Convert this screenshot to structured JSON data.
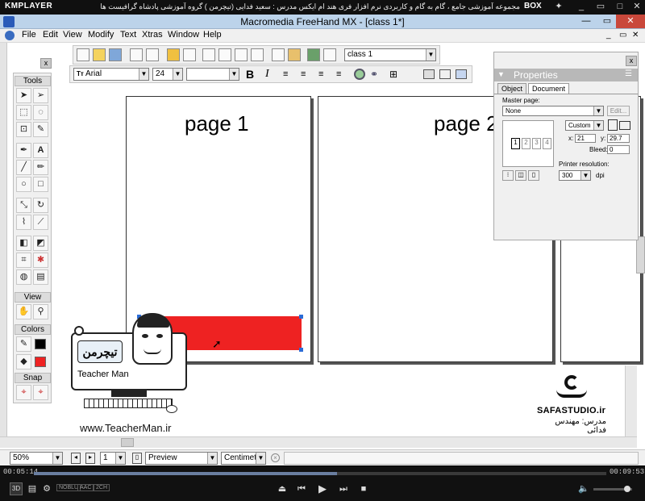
{
  "player": {
    "logo": "KMPLAYER",
    "title": "مجموعه آموزشی جامع ، گام به گام و کاربردی نرم افزار فری هند ام ایکس   مدرس : سعید فدایی (تیچرمن ) گروه آموزشی پادشاه گرافیست ها",
    "box_label": "BOX",
    "time_current": "00:05:14",
    "time_total": "00:09:53",
    "progress": 0.53,
    "badges": [
      "NOBLU",
      "AAC",
      "2CH"
    ]
  },
  "app": {
    "title": "Macromedia FreeHand MX - [class 1*]",
    "menu": [
      "File",
      "Edit",
      "View",
      "Modify",
      "Text",
      "Xtras",
      "Window",
      "Help"
    ]
  },
  "toolbar": {
    "document_select": "class 1",
    "font_name": "Arial",
    "font_size": "24",
    "bold_label": "B",
    "italic_label": "I"
  },
  "tools_panel": {
    "title": "Tools",
    "view_title": "View",
    "colors_title": "Colors",
    "snap_title": "Snap",
    "close": "x"
  },
  "pages": [
    {
      "label": "page 1"
    },
    {
      "label": "page 2"
    }
  ],
  "properties": {
    "title": "Properties",
    "tabs": [
      "Object",
      "Document"
    ],
    "master_page_label": "Master page:",
    "master_page_value": "None",
    "edit_button": "Edit...",
    "page_size_value": "Custom",
    "x_label": "x:",
    "x_value": "21",
    "y_label": "y:",
    "y_value": "29.7",
    "bleed_label": "Bleed:",
    "bleed_value": "0",
    "thumbs": [
      "1",
      "2",
      "3",
      "4"
    ],
    "printer_resolution_label": "Printer resolution:",
    "printer_resolution_value": "300",
    "dpi_label": "dpi"
  },
  "status": {
    "zoom": "50%",
    "page_number": "1",
    "view_mode": "Preview",
    "units": "Centimeters"
  },
  "watermarks": {
    "teacherman_url": "www.TeacherMan.ir",
    "teacherman_name": "Teacher Man",
    "teacherman_logo_text": "تیچرمن",
    "safa_studio": "SAFASTUDIO.ir",
    "instructor_line": "مدرس: مهندس فدائی"
  },
  "colors": {
    "red_rect": "#ee2222",
    "title_bar": "#bcd3ea"
  }
}
